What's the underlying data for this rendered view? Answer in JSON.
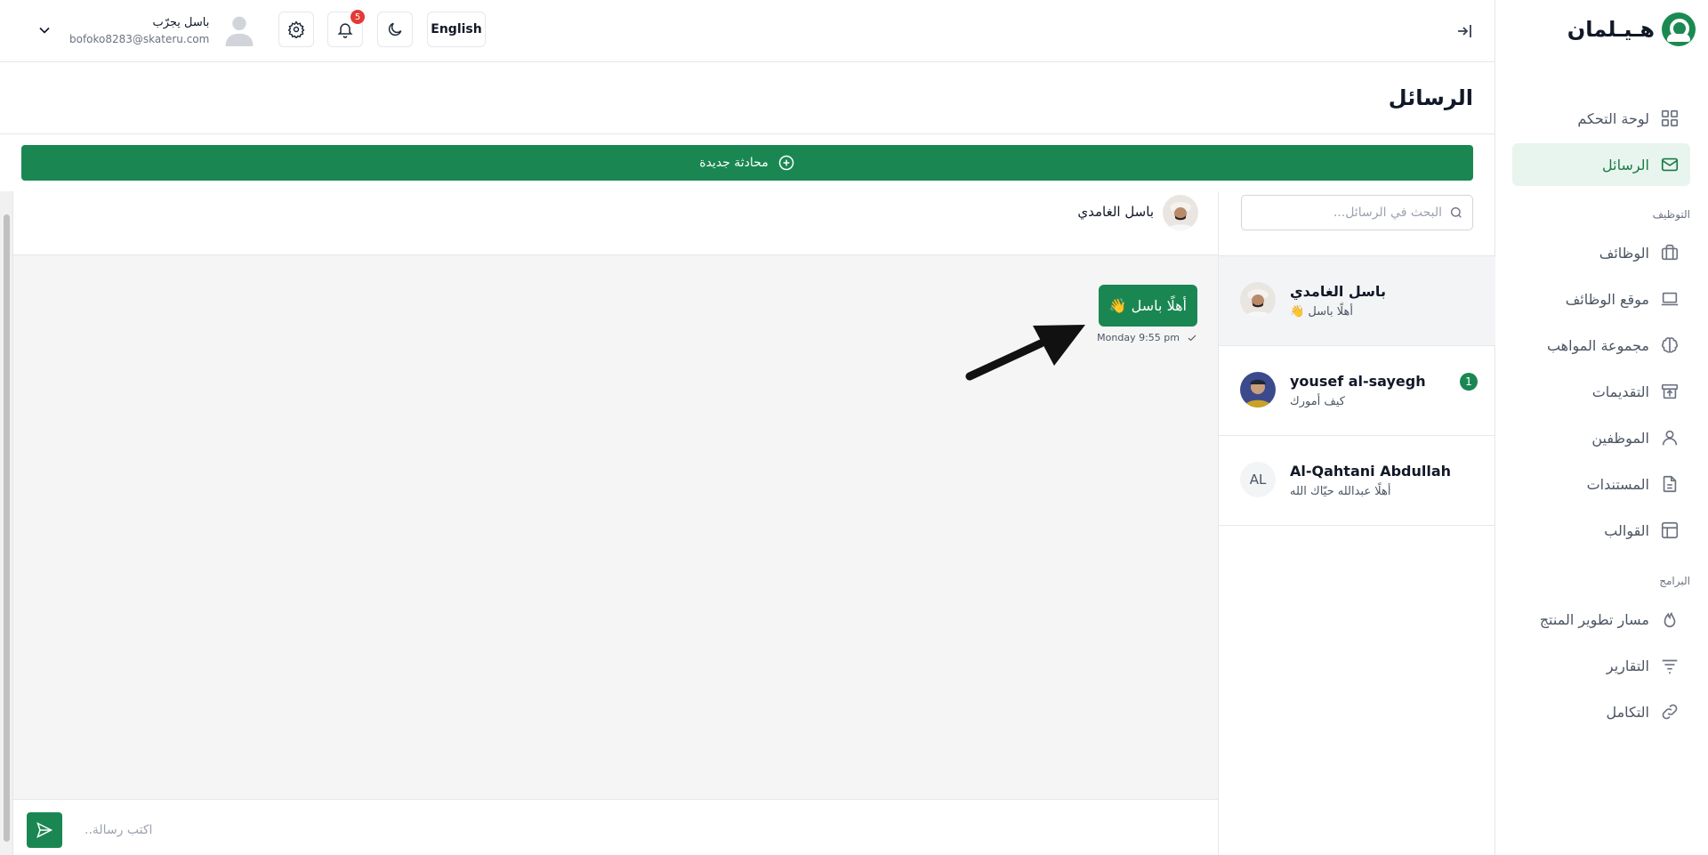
{
  "app": {
    "brand_name": "هـيـلمان"
  },
  "sidebar": {
    "items": [
      {
        "label": "لوحة التحكم",
        "icon": "dashboard-grid-icon"
      },
      {
        "label": "الرسائل",
        "icon": "mail-icon",
        "active": true
      }
    ],
    "section_hiring": "التوظيف",
    "hiring_items": [
      {
        "label": "الوظائف",
        "icon": "briefcase-icon"
      },
      {
        "label": "موقع الوظائف",
        "icon": "laptop-icon"
      },
      {
        "label": "مجموعة المواهب",
        "icon": "brain-icon"
      },
      {
        "label": "التقديمات",
        "icon": "inbox-upload-icon"
      },
      {
        "label": "الموظفين",
        "icon": "user-icon"
      },
      {
        "label": "المستندات",
        "icon": "document-icon"
      },
      {
        "label": "القوالب",
        "icon": "layout-template-icon"
      }
    ],
    "section_programs": "البرامج",
    "program_items": [
      {
        "label": "مسار تطوير المنتج",
        "icon": "flame-icon"
      },
      {
        "label": "التقارير",
        "icon": "filter-lines-icon"
      },
      {
        "label": "التكامل",
        "icon": "link-icon"
      }
    ]
  },
  "topbar": {
    "user_name": "باسل يجرّب",
    "user_email": "bofoko8283@skateru.com",
    "notifications_count": "5",
    "language_label": "English"
  },
  "page": {
    "title": "الرسائل",
    "new_chat_label": "محادثة جديدة"
  },
  "chat_list": {
    "search_placeholder": "البحث في الرسائل...",
    "conversations": [
      {
        "name": "باسل الغامدي",
        "preview": "أهلًا باسل 👋",
        "selected": true
      },
      {
        "name": "yousef al-sayegh",
        "preview": "كيف أمورك",
        "unread": "1"
      },
      {
        "name": "Al-Qahtani Abdullah",
        "preview": "أهلًا عبدالله حيّاك الله",
        "initials": "AL"
      }
    ]
  },
  "chat": {
    "contact_name": "باسل الغامدي",
    "messages": [
      {
        "text": "أهلًا باسل 👋",
        "time": "Monday 9:55 pm"
      }
    ],
    "composer_placeholder": "اكتب رسالة.."
  },
  "colors": {
    "brand_green": "#1a8752",
    "active_nav_bg": "#e8f5ee",
    "badge_red": "#e53935"
  }
}
